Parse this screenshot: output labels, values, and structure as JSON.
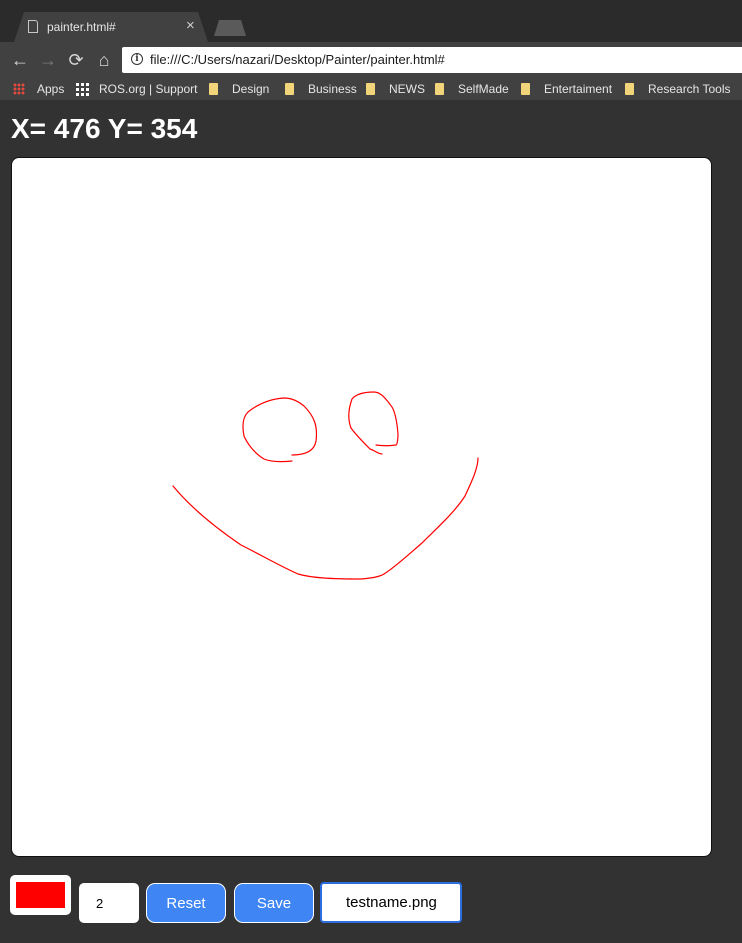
{
  "browser": {
    "tab_title": "painter.html#",
    "tab_close": "×",
    "url": "file:///C:/Users/nazari/Desktop/Painter/painter.html#",
    "nav": {
      "back": "←",
      "forward": "→",
      "reload": "⟳",
      "home": "⌂"
    },
    "bookmarks": [
      {
        "label": "Apps",
        "icon": "apps-icon"
      },
      {
        "label": "ROS.org | Support",
        "icon": "ros-icon"
      },
      {
        "label": "Design",
        "icon": "folder-icon"
      },
      {
        "label": "Business",
        "icon": "folder-icon"
      },
      {
        "label": "NEWS",
        "icon": "folder-icon"
      },
      {
        "label": "SelfMade",
        "icon": "folder-icon"
      },
      {
        "label": "Entertaiment",
        "icon": "folder-icon"
      },
      {
        "label": "Research Tools",
        "icon": "folder-icon"
      }
    ]
  },
  "painter": {
    "coords_text": "X= 476 Y= 354",
    "stroke_color": "#ff0000",
    "brush_size": "2",
    "reset_label": "Reset",
    "save_label": "Save",
    "filename_value": "testname.png"
  },
  "colors": {
    "page_bg": "#323232",
    "button_bg": "#3f86f4",
    "stroke": "#ff0000"
  }
}
